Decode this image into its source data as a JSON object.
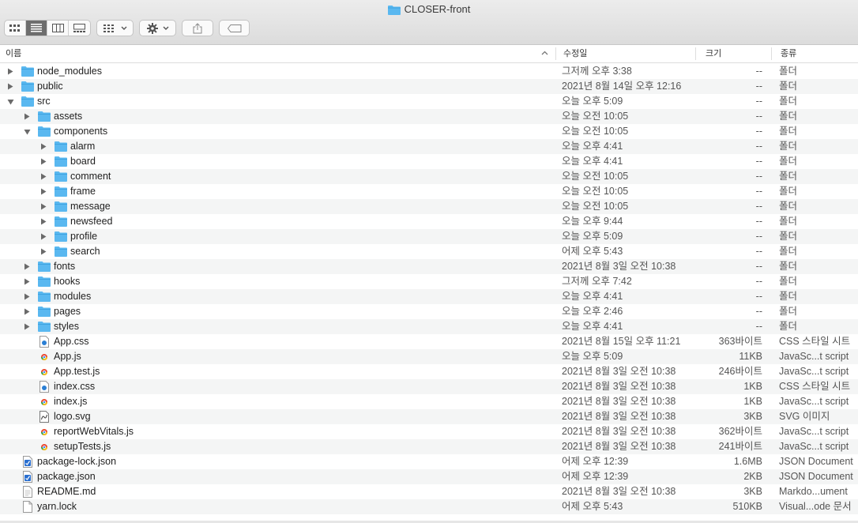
{
  "window": {
    "title": "CLOSER-front"
  },
  "columns": {
    "name": "이름",
    "date": "수정일",
    "size": "크기",
    "kind": "종류"
  },
  "rows": [
    {
      "name": "node_modules",
      "date": "그저께 오후 3:38",
      "size": "--",
      "kind": "폴더",
      "type": "folder",
      "level": 0,
      "disclosure": "closed"
    },
    {
      "name": "public",
      "date": "2021년 8월 14일 오후 12:16",
      "size": "--",
      "kind": "폴더",
      "type": "folder",
      "level": 0,
      "disclosure": "closed"
    },
    {
      "name": "src",
      "date": "오늘 오후 5:09",
      "size": "--",
      "kind": "폴더",
      "type": "folder",
      "level": 0,
      "disclosure": "open"
    },
    {
      "name": "assets",
      "date": "오늘 오전 10:05",
      "size": "--",
      "kind": "폴더",
      "type": "folder",
      "level": 1,
      "disclosure": "closed"
    },
    {
      "name": "components",
      "date": "오늘 오전 10:05",
      "size": "--",
      "kind": "폴더",
      "type": "folder",
      "level": 1,
      "disclosure": "open"
    },
    {
      "name": "alarm",
      "date": "오늘 오후 4:41",
      "size": "--",
      "kind": "폴더",
      "type": "folder",
      "level": 2,
      "disclosure": "closed"
    },
    {
      "name": "board",
      "date": "오늘 오후 4:41",
      "size": "--",
      "kind": "폴더",
      "type": "folder",
      "level": 2,
      "disclosure": "closed"
    },
    {
      "name": "comment",
      "date": "오늘 오전 10:05",
      "size": "--",
      "kind": "폴더",
      "type": "folder",
      "level": 2,
      "disclosure": "closed"
    },
    {
      "name": "frame",
      "date": "오늘 오전 10:05",
      "size": "--",
      "kind": "폴더",
      "type": "folder",
      "level": 2,
      "disclosure": "closed"
    },
    {
      "name": "message",
      "date": "오늘 오전 10:05",
      "size": "--",
      "kind": "폴더",
      "type": "folder",
      "level": 2,
      "disclosure": "closed"
    },
    {
      "name": "newsfeed",
      "date": "오늘 오후 9:44",
      "size": "--",
      "kind": "폴더",
      "type": "folder",
      "level": 2,
      "disclosure": "closed"
    },
    {
      "name": "profile",
      "date": "오늘 오후 5:09",
      "size": "--",
      "kind": "폴더",
      "type": "folder",
      "level": 2,
      "disclosure": "closed"
    },
    {
      "name": "search",
      "date": "어제 오후 5:43",
      "size": "--",
      "kind": "폴더",
      "type": "folder",
      "level": 2,
      "disclosure": "closed"
    },
    {
      "name": "fonts",
      "date": "2021년 8월 3일 오전 10:38",
      "size": "--",
      "kind": "폴더",
      "type": "folder",
      "level": 1,
      "disclosure": "closed"
    },
    {
      "name": "hooks",
      "date": "그저께 오후 7:42",
      "size": "--",
      "kind": "폴더",
      "type": "folder",
      "level": 1,
      "disclosure": "closed"
    },
    {
      "name": "modules",
      "date": "오늘 오후 4:41",
      "size": "--",
      "kind": "폴더",
      "type": "folder",
      "level": 1,
      "disclosure": "closed"
    },
    {
      "name": "pages",
      "date": "오늘 오후 2:46",
      "size": "--",
      "kind": "폴더",
      "type": "folder",
      "level": 1,
      "disclosure": "closed"
    },
    {
      "name": "styles",
      "date": "오늘 오후 4:41",
      "size": "--",
      "kind": "폴더",
      "type": "folder",
      "level": 1,
      "disclosure": "closed"
    },
    {
      "name": "App.css",
      "date": "2021년 8월 15일 오후 11:21",
      "size": "363바이트",
      "kind": "CSS 스타일 시트",
      "type": "css",
      "level": 1,
      "disclosure": "none"
    },
    {
      "name": "App.js",
      "date": "오늘 오후 5:09",
      "size": "11KB",
      "kind": "JavaSc...t script",
      "type": "js",
      "level": 1,
      "disclosure": "none"
    },
    {
      "name": "App.test.js",
      "date": "2021년 8월 3일 오전 10:38",
      "size": "246바이트",
      "kind": "JavaSc...t script",
      "type": "js",
      "level": 1,
      "disclosure": "none"
    },
    {
      "name": "index.css",
      "date": "2021년 8월 3일 오전 10:38",
      "size": "1KB",
      "kind": "CSS 스타일 시트",
      "type": "css",
      "level": 1,
      "disclosure": "none"
    },
    {
      "name": "index.js",
      "date": "2021년 8월 3일 오전 10:38",
      "size": "1KB",
      "kind": "JavaSc...t script",
      "type": "js",
      "level": 1,
      "disclosure": "none"
    },
    {
      "name": "logo.svg",
      "date": "2021년 8월 3일 오전 10:38",
      "size": "3KB",
      "kind": "SVG 이미지",
      "type": "svg",
      "level": 1,
      "disclosure": "none"
    },
    {
      "name": "reportWebVitals.js",
      "date": "2021년 8월 3일 오전 10:38",
      "size": "362바이트",
      "kind": "JavaSc...t script",
      "type": "js",
      "level": 1,
      "disclosure": "none"
    },
    {
      "name": "setupTests.js",
      "date": "2021년 8월 3일 오전 10:38",
      "size": "241바이트",
      "kind": "JavaSc...t script",
      "type": "js",
      "level": 1,
      "disclosure": "none"
    },
    {
      "name": "package-lock.json",
      "date": "어제 오후 12:39",
      "size": "1.6MB",
      "kind": "JSON Document",
      "type": "json",
      "level": 0,
      "disclosure": "none"
    },
    {
      "name": "package.json",
      "date": "어제 오후 12:39",
      "size": "2KB",
      "kind": "JSON Document",
      "type": "json",
      "level": 0,
      "disclosure": "none"
    },
    {
      "name": "README.md",
      "date": "2021년 8월 3일 오전 10:38",
      "size": "3KB",
      "kind": "Markdo...ument",
      "type": "md",
      "level": 0,
      "disclosure": "none"
    },
    {
      "name": "yarn.lock",
      "date": "어제 오후 5:43",
      "size": "510KB",
      "kind": "Visual...ode 문서",
      "type": "doc",
      "level": 0,
      "disclosure": "none"
    }
  ],
  "colors": {
    "folder": "#5ab8f0",
    "folderTab": "#3ea3e0",
    "active_segment": "#6e6e6e"
  }
}
